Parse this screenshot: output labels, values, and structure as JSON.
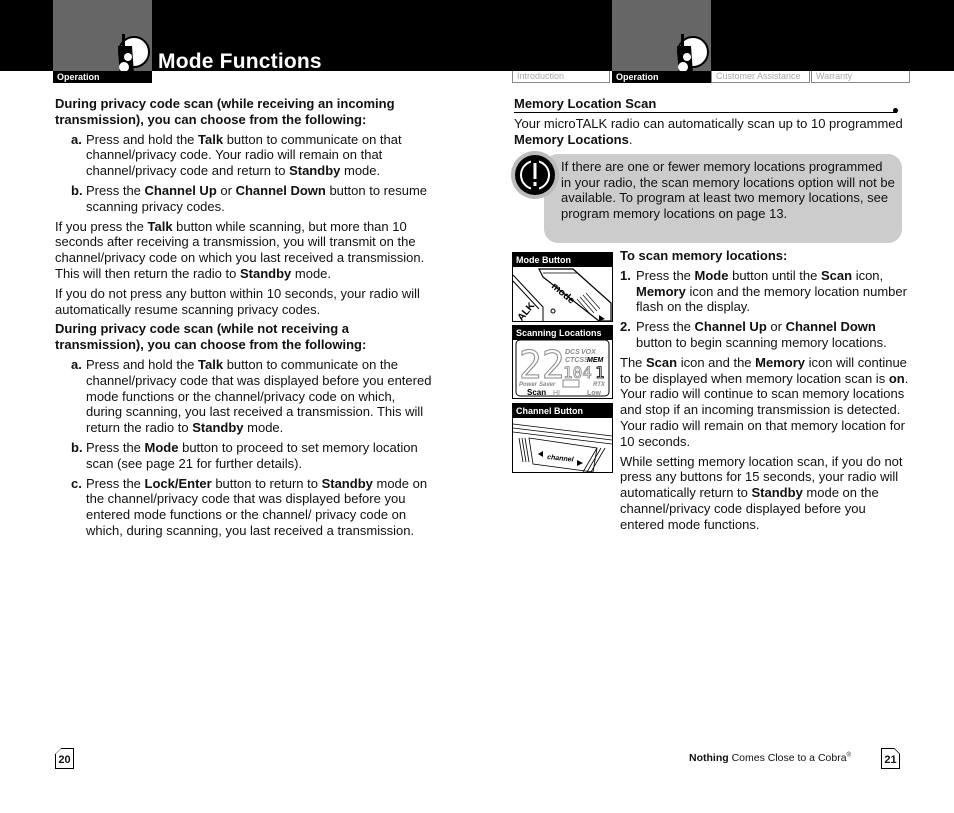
{
  "header": {
    "title": "Mode Functions",
    "left_section_tab": "Operation",
    "right_tabs": [
      {
        "label": "Introduction",
        "active": false
      },
      {
        "label": "Operation",
        "active": true
      },
      {
        "label": "Customer Assistance",
        "active": false
      },
      {
        "label": "Warranty",
        "active": false
      }
    ],
    "icon": "walkie-talkie-icon"
  },
  "left_page": {
    "heading1": "During privacy code scan (while receiving an incoming transmission), you can choose from the following:",
    "list1": [
      {
        "label": "a.",
        "pre": "Press and hold the ",
        "b1": "Talk",
        "mid": " button to communicate on that channel/privacy code. Your radio will remain on that channel/privacy code and return to ",
        "b2": "Standby",
        "post": " mode."
      },
      {
        "label": "b.",
        "pre": "Press the ",
        "b1": "Channel Up",
        "mid": " or ",
        "b2": "Channel Down",
        "post": " button to resume scanning privacy codes."
      }
    ],
    "para1": {
      "pre": "If you press the ",
      "b1": "Talk",
      "mid": " button while scanning, but more than 10 seconds after receiving a transmission, you will transmit on the channel/privacy code on which you last received a transmission. This will then return the radio to ",
      "b2": "Standby",
      "post": " mode."
    },
    "para2": "If you do not press any button within 10 seconds, your radio will automatically resume scanning privacy codes.",
    "heading2": "During privacy code scan (while not receiving a transmission), you can choose from the following:",
    "list2": [
      {
        "label": "a.",
        "pre": "Press and hold the ",
        "b1": "Talk",
        "mid": " button to communicate on the channel/privacy code that was displayed before you entered mode functions or the channel/privacy code on which, during scanning, you last received a transmission. This will return the radio to ",
        "b2": "Standby",
        "post": " mode."
      },
      {
        "label": "b.",
        "pre": "Press the ",
        "b1": "Mode",
        "mid": " button to proceed to set memory location scan (see page 21 for further details).",
        "b2": "",
        "post": ""
      },
      {
        "label": "c.",
        "pre": "Press the ",
        "b1": "Lock/Enter",
        "mid": " button to return to ",
        "b2": "Standby",
        "post": " mode on the channel/privacy code that was displayed before you entered mode functions or the channel/ privacy code on which, during scanning, you last received a transmission."
      }
    ],
    "page_number": "20"
  },
  "right_page": {
    "section_title": "Memory Location Scan",
    "intro": {
      "pre": "Your microTALK radio can automatically scan up to 10 programmed ",
      "b1": "Memory Locations",
      "post": "."
    },
    "note": {
      "icon": "caution-icon",
      "text": "If there are one or fewer memory locations programmed in your radio, the scan memory locations option will not be available. To program at least two memory locations, see program memory locations on page 13."
    },
    "figures": [
      {
        "caption": "Mode Button",
        "button_text": "mode",
        "talk_text": "ALK"
      },
      {
        "caption": "Scanning Locations",
        "lcd": {
          "channel": "22",
          "code": "104",
          "mem": "1",
          "labels": [
            "DCS",
            "VOX",
            "CTCSS",
            "MEM",
            "Power",
            "Saver",
            "Scan",
            "HI",
            "RTX",
            "Low"
          ]
        }
      },
      {
        "caption": "Channel Button",
        "button_text": "channel"
      }
    ],
    "steps_heading": "To scan memory locations:",
    "steps": [
      {
        "label": "1.",
        "pre": "Press the ",
        "b1": "Mode",
        "mid": " button until the ",
        "b2": "Scan",
        "mid2": " icon, ",
        "b3": "Memory",
        "post": " icon and the memory location number flash on the display."
      },
      {
        "label": "2.",
        "pre": "Press the ",
        "b1": "Channel Up",
        "mid": " or ",
        "b2": "Channel Down",
        "mid2": " button to begin scanning memory locations.",
        "b3": "",
        "post": ""
      }
    ],
    "para1": {
      "pre": "The ",
      "b1": "Scan",
      "mid": " icon and the ",
      "b2": "Memory",
      "mid2": " icon will continue to be displayed when memory location scan is ",
      "b3": "on",
      "post": ". Your radio will continue to scan memory locations and stop if an incoming transmission is detected. Your radio will remain on that memory location for 10 seconds."
    },
    "para2": {
      "pre": "While setting memory location scan, if you do not press any buttons for 15 seconds, your radio will automatically return to ",
      "b1": "Standby",
      "post": " mode on the channel/privacy code displayed before you entered mode functions."
    },
    "footer": {
      "bold": "Nothing",
      "rest": " Comes Close to a Cobra",
      "reg": "®"
    },
    "page_number": "21"
  }
}
